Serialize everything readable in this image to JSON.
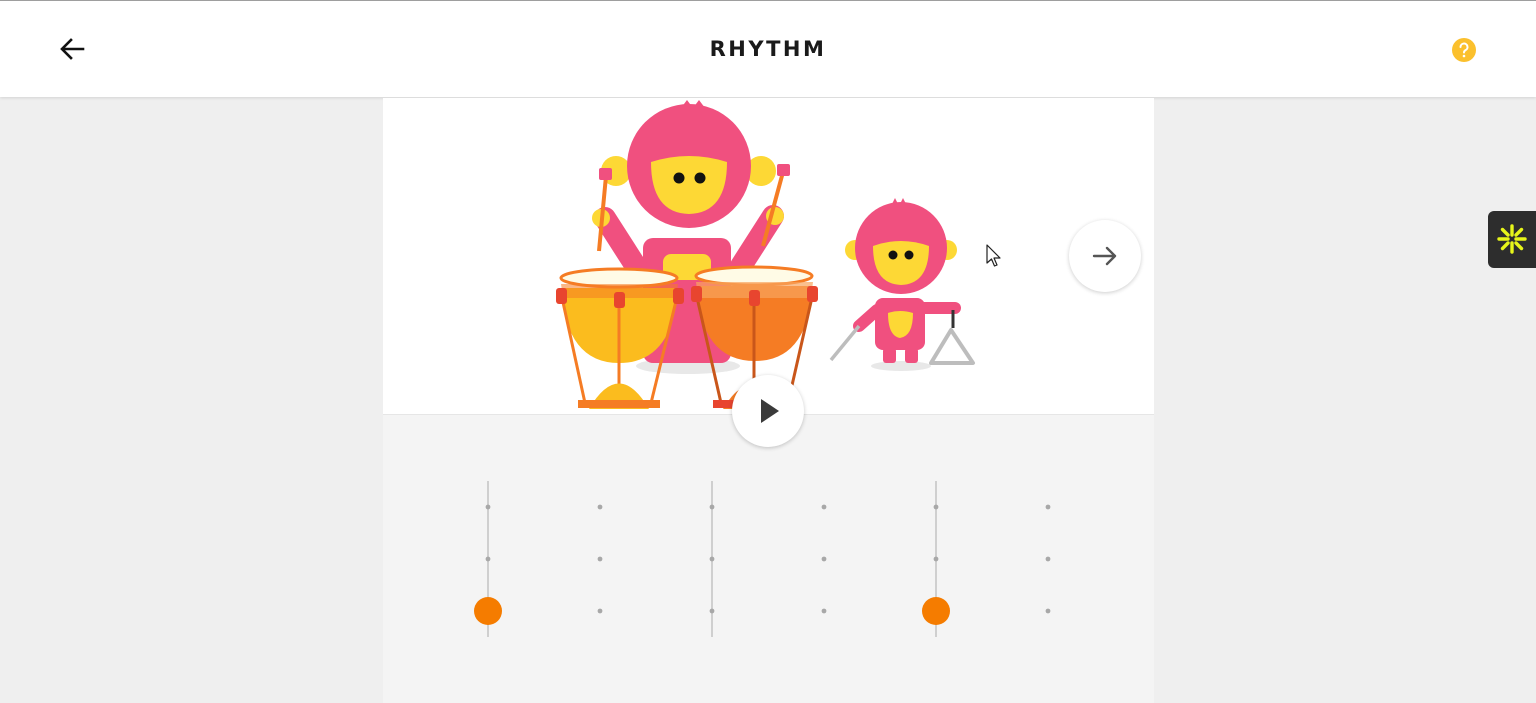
{
  "header": {
    "back_icon": "arrow-left-icon",
    "title": "RHYTHM",
    "help_icon": "help-circle-icon",
    "help_color": "#fbc02d"
  },
  "stage": {
    "characters": [
      "drummer-monkey",
      "triangle-monkey"
    ],
    "next_icon": "arrow-right-icon",
    "play_icon": "play-icon"
  },
  "sequencer": {
    "columns": 6,
    "rows": 3,
    "active_notes": [
      {
        "column": 1,
        "row": 3
      },
      {
        "column": 5,
        "row": 3
      }
    ],
    "note_color": "#f57c00",
    "beat_line_columns": [
      1,
      3,
      5
    ]
  },
  "side_widget": {
    "icon": "asterisk-icon",
    "icon_color": "#e6f51a"
  },
  "colors": {
    "monkey_pink": "#f0507f",
    "monkey_yellow": "#fdd835",
    "drum_yellow": "#fbbc1e",
    "drum_orange": "#f57c24"
  }
}
